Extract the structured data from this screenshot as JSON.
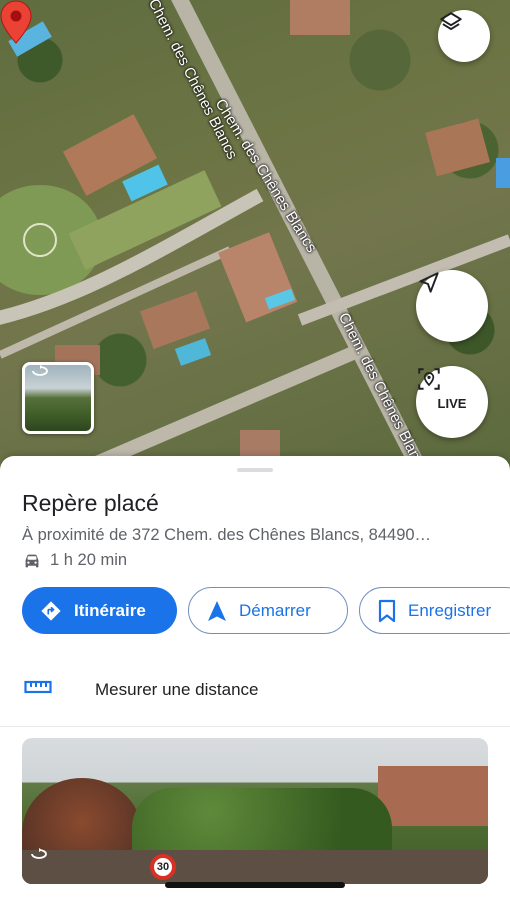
{
  "map": {
    "street_labels": [
      "Chem. des Chênes Blancs",
      "Chem. des Chênes Blancs",
      "Chem. des Chênes Blancs"
    ],
    "live_label": "LIVE",
    "icons": [
      "layers-icon",
      "navigation-arrow-icon",
      "live-view-icon",
      "street-view-icon",
      "location-pin-icon"
    ]
  },
  "place": {
    "title": "Repère placé",
    "address": "À proximité de 372 Chem. des Chênes Blancs, 84490…",
    "travel_time": "1 h 20 min",
    "travel_mode_icon": "car-icon"
  },
  "actions": {
    "route_label": "Itinéraire",
    "start_label": "Démarrer",
    "save_label": "Enregistrer"
  },
  "measure": {
    "label": "Mesurer une distance"
  },
  "photo": {
    "sign_text": "30"
  },
  "colors": {
    "accent": "#1a73e8",
    "pin": "#ea4335",
    "text_primary": "#202124",
    "text_secondary": "#5f6368"
  }
}
